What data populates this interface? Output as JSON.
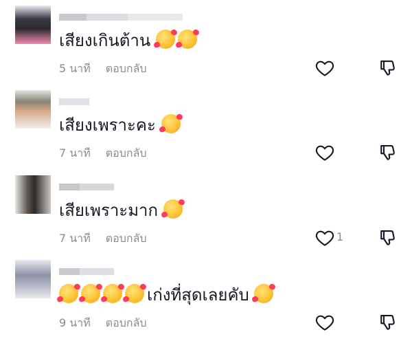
{
  "comments": [
    {
      "text": "เสียงเกินต้าน",
      "emojis_after": 2,
      "emojis_before": 0,
      "time": "5 นาที",
      "reply": "ตอบกลับ",
      "likes": ""
    },
    {
      "text": "เสียงเพราะคะ",
      "emojis_after": 1,
      "emojis_before": 0,
      "time": "7 นาที",
      "reply": "ตอบกลับ",
      "likes": ""
    },
    {
      "text": "เสียเพราะมาก",
      "emojis_after": 1,
      "emojis_before": 0,
      "time": "7 นาที",
      "reply": "ตอบกลับ",
      "likes": "1"
    },
    {
      "text": "เก่งที่สุดเลยคับ",
      "emojis_after": 1,
      "emojis_before": 4,
      "time": "9 นาที",
      "reply": "ตอบกลับ",
      "likes": ""
    }
  ],
  "icons": {
    "emoji": "smiling-face-with-hearts",
    "like": "heart-outline-icon",
    "dislike": "thumbs-down-outline-icon"
  },
  "colors": {
    "text": "#161823",
    "meta": "#8a8b91",
    "icon": "#161823"
  }
}
